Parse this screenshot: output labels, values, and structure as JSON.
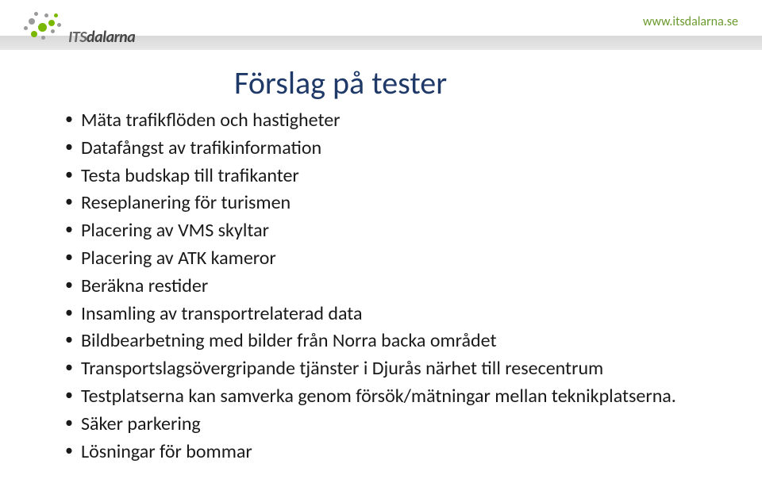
{
  "header": {
    "url": "www.itsdalarna.se",
    "logo_text": "ITSdalarna"
  },
  "title": "Förslag på tester",
  "items": [
    "Mäta trafikflöden och hastigheter",
    "Datafångst av trafikinformation",
    "Testa budskap till trafikanter",
    "Reseplanering för turismen",
    "Placering av VMS skyltar",
    "Placering av ATK kameror",
    "Beräkna restider",
    "Insamling av transportrelaterad data",
    "Bildbearbetning med bilder från Norra backa området",
    "Transportslagsövergripande tjänster i Djurås närhet till resecentrum",
    "Testplatserna kan samverka genom försök/mätningar mellan teknikplatserna.",
    "Säker parkering",
    "Lösningar för bommar"
  ]
}
